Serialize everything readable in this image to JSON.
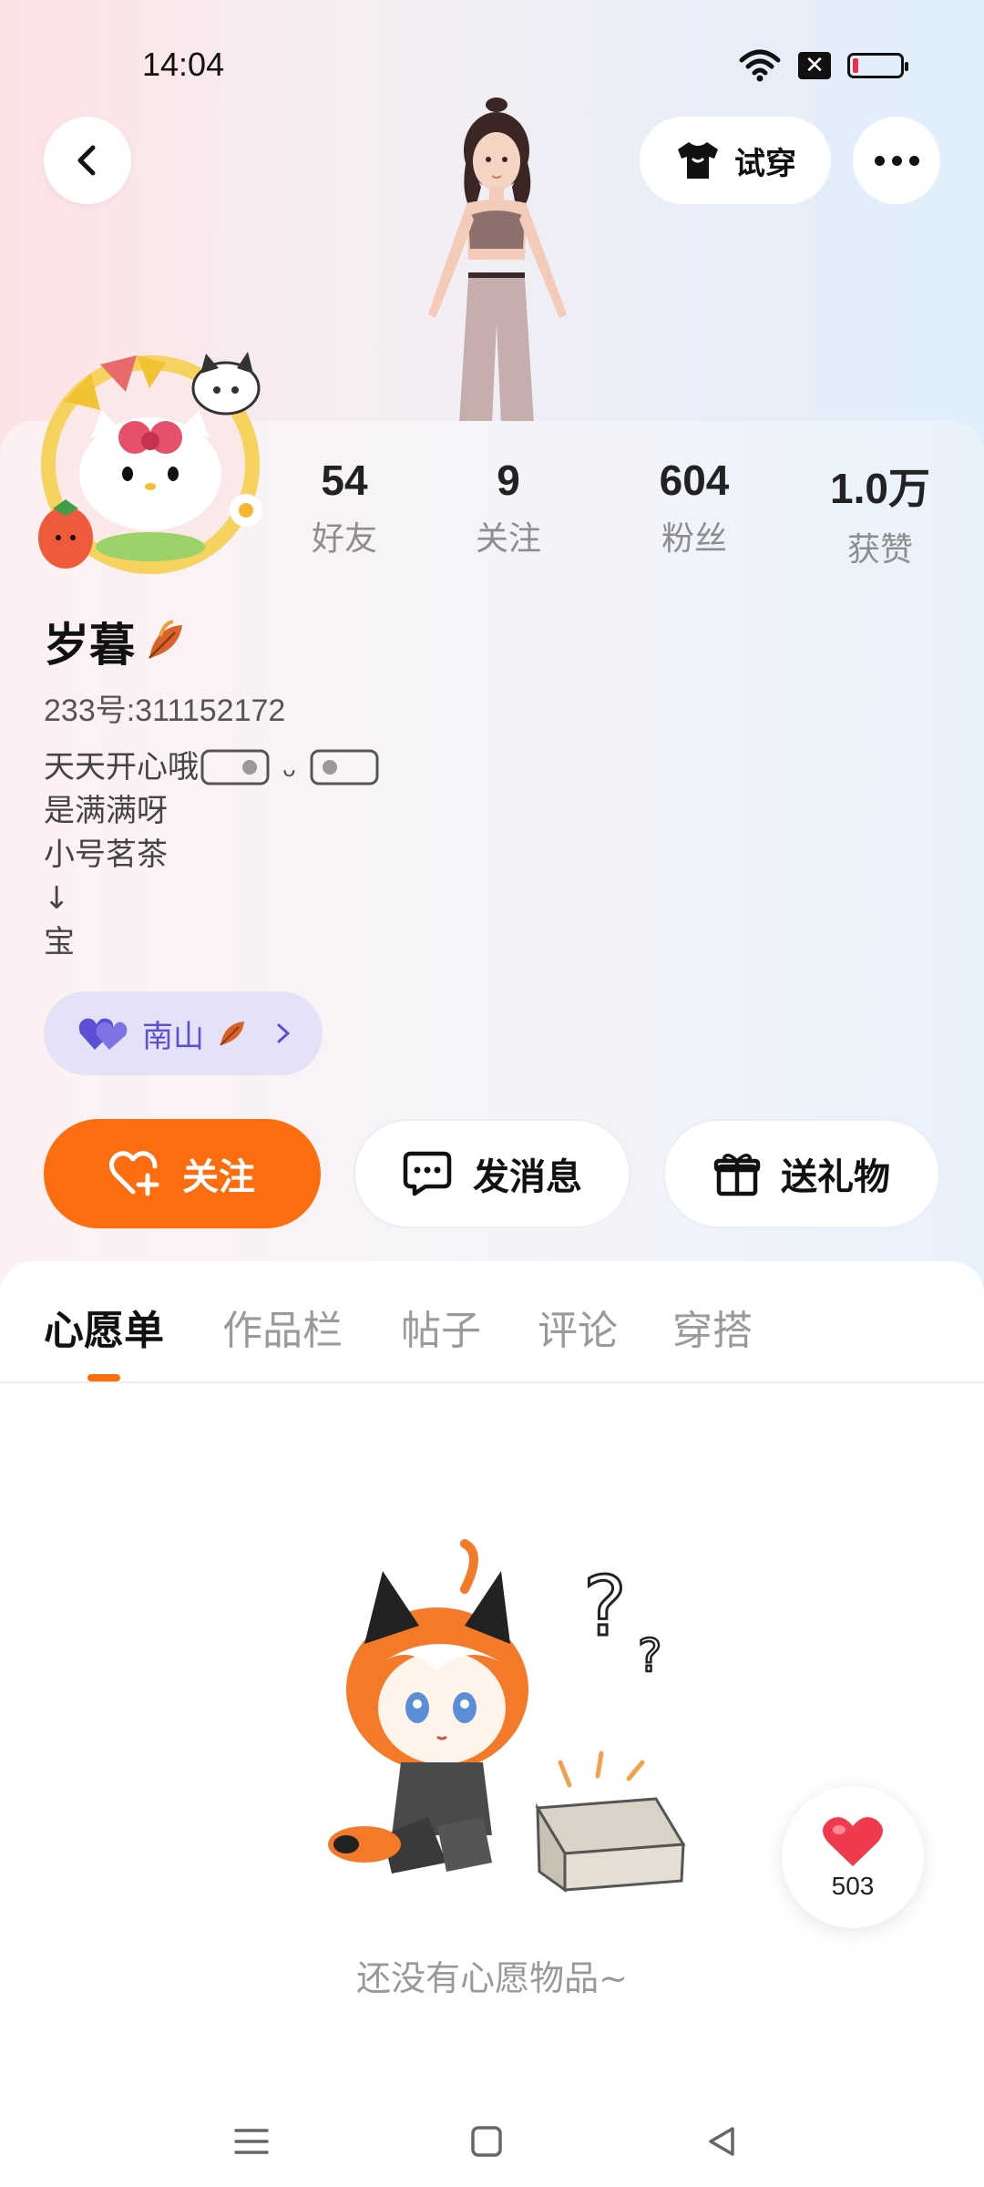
{
  "status_bar": {
    "time": "14:04",
    "icons": [
      "wifi-icon",
      "x-box-icon",
      "battery-low-icon"
    ]
  },
  "header": {
    "try_on_label": "试穿",
    "back_icon": "chevron-left-icon",
    "more_icon": "more-dots-icon",
    "shirt_icon": "tshirt-icon"
  },
  "stats": [
    {
      "value": "54",
      "label": "好友"
    },
    {
      "value": "9",
      "label": "关注"
    },
    {
      "value": "604",
      "label": "粉丝"
    },
    {
      "value": "1.0万",
      "label": "获赞"
    }
  ],
  "profile": {
    "name": "岁暮",
    "account_id": "233号:311152172",
    "bio_lines": [
      "天天开心哦",
      "是满满呀",
      "小号茗茶",
      "↓",
      "宝"
    ],
    "cp_tag": {
      "label": "南山",
      "icon": "double-heart-icon"
    }
  },
  "actions": {
    "follow_label": "关注",
    "message_label": "发消息",
    "gift_label": "送礼物"
  },
  "tabs": [
    {
      "label": "心愿单",
      "active": true
    },
    {
      "label": "作品栏",
      "active": false
    },
    {
      "label": "帖子",
      "active": false
    },
    {
      "label": "评论",
      "active": false
    },
    {
      "label": "穿搭",
      "active": false
    }
  ],
  "empty_state": {
    "text": "还没有心愿物品~"
  },
  "like_float": {
    "count": "503",
    "icon": "heart-icon"
  },
  "colors": {
    "accent": "#fc6d10",
    "cp_tag_bg": "#e5e1f7",
    "cp_tag_text": "#5b4fd6"
  }
}
